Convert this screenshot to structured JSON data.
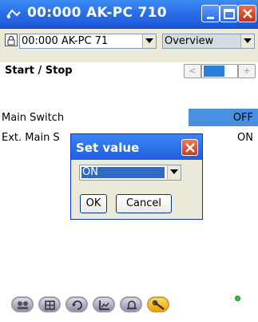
{
  "window": {
    "title": "00:000 AK-PC 710"
  },
  "toolbar": {
    "device_combo": "00:000 AK-PC 71",
    "view_combo": "Overview"
  },
  "section": {
    "title": "Start / Stop"
  },
  "nav": {
    "prev_symbol": "<",
    "next_symbol": "+"
  },
  "rows": [
    {
      "label": "Main Switch",
      "value": "OFF"
    },
    {
      "label": "Ext. Main S",
      "value": "ON"
    }
  ],
  "dialog": {
    "title": "Set value",
    "selected": "ON",
    "ok": "OK",
    "cancel": "Cancel"
  },
  "bottombar": {
    "buttons": [
      "people-icon",
      "grid-icon",
      "refresh-icon",
      "chart-icon",
      "alarm-bell-icon",
      "wrench-icon"
    ]
  },
  "colors": {
    "titlebar": "#2a6fe8",
    "highlight": "#4a90e0",
    "status_led": "#3cbf3c"
  }
}
